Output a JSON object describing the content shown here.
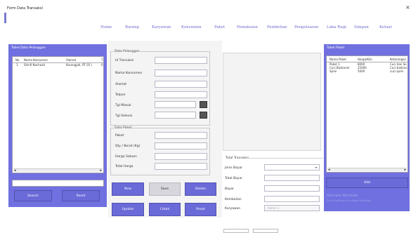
{
  "window": {
    "title": "Form Data Transaksi",
    "close": "×"
  },
  "nav": [
    "Home",
    "Barang",
    "Karyawan",
    "Konsumen",
    "Paket",
    "Pemakaian",
    "Pembelian",
    "Pengeluaran",
    "Laba Rugi",
    "Simpan",
    "Keluar"
  ],
  "pelanggan_panel": {
    "title": "Tabel Data Pelanggan",
    "columns": [
      "No",
      "Nama Konsumen",
      "Alamat",
      "T"
    ],
    "rows": [
      [
        "1",
        "Shinfi Nachoah",
        "Karangjati, RT 05 (",
        "0"
      ]
    ],
    "search": "Search",
    "reset": "Reset"
  },
  "paket_panel": {
    "title": "Tabel Paket",
    "columns": [
      "Nama Paket",
      "Harga/Kilo",
      "Keterangan"
    ],
    "rows": [
      [
        "Paket 1",
        "8000",
        "Cuci dan Se"
      ],
      [
        "Cuci Badcover",
        "25000",
        "Cuci badcov"
      ],
      [
        "Sprei",
        "5000",
        "cuci sprei"
      ]
    ],
    "add": "Add",
    "faded_lines": [
      "Activate Windows",
      "Go to Settings to activate Windows."
    ]
  },
  "data_pelanggan": {
    "title": "Data Pelanggan",
    "labels": [
      "Id Transaksi",
      "Nama Konsumen",
      "Alamat",
      "Telpon",
      "Tgl Masuk",
      "Tgl Selesai"
    ],
    "dots": "..."
  },
  "data_paket": {
    "title": "Data Paket",
    "labels": [
      "Paket",
      "Qty / Berat (Kg)",
      "Harga Satuan",
      "Total Harga"
    ]
  },
  "actions": {
    "new": "New",
    "save": "Save",
    "delete": "Delete",
    "update": "Update",
    "cetak": "Cetak",
    "reset": "Reset"
  },
  "total_transaksi": {
    "title": "Total Transaksi",
    "labels": [
      "Jenis Bayar",
      "Total Bayar",
      "Bayar",
      "Kembalian",
      "Karyawan"
    ],
    "karyawan_value": "Admin 1"
  }
}
